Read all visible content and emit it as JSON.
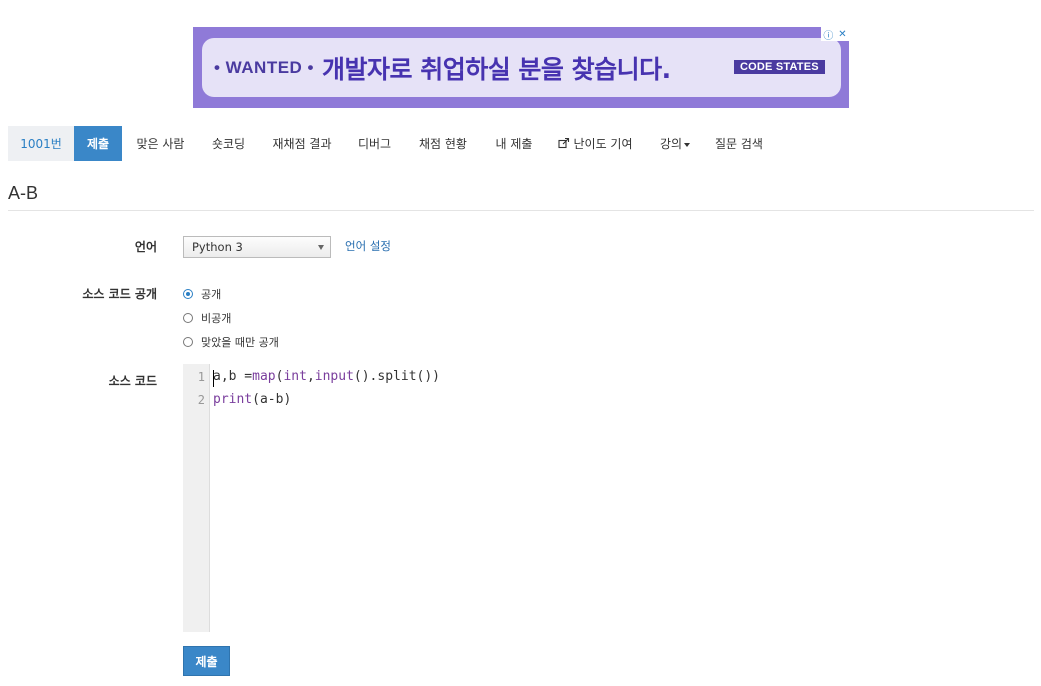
{
  "ad": {
    "brand": "• WANTED •",
    "headline": "개발자로 취업하실 분을 찾습니다.",
    "badge": "CODE STATES",
    "choices_info": "ⓘ",
    "choices_close": "✕"
  },
  "nav": {
    "problem": "1001번",
    "submit": "제출",
    "solved": "맞은 사람",
    "shortcode": "숏코딩",
    "rejudge": "재채점 결과",
    "debug": "디버그",
    "status": "채점 현황",
    "my_submit": "내 제출",
    "difficulty": "난이도 기여",
    "lecture": "강의",
    "qna": "질문 검색"
  },
  "page": {
    "title": "A-B"
  },
  "form": {
    "language_label": "언어",
    "language_value": "Python 3",
    "language_settings": "언어 설정",
    "visibility_label": "소스 코드 공개",
    "visibility_options": [
      "공개",
      "비공개",
      "맞았을 때만 공개"
    ],
    "visibility_selected": "공개",
    "source_label": "소스 코드",
    "submit_button": "제출"
  },
  "editor": {
    "line_numbers": [
      "1",
      "2"
    ],
    "lines": [
      "a,b =map(int,input().split())",
      "print(a-b)"
    ]
  },
  "colors": {
    "accent": "#3a87c8",
    "ad_background": "#8f7ad8",
    "ad_text": "#4733b0"
  }
}
